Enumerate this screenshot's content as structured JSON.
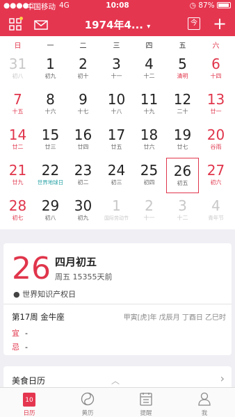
{
  "status": {
    "carrier": "中国移动",
    "network": "4G",
    "time": "10:08",
    "battery": "87%"
  },
  "nav": {
    "title": "1974年4...",
    "today_icon_text": "今"
  },
  "weekdays": [
    "日",
    "一",
    "二",
    "三",
    "四",
    "五",
    "六"
  ],
  "calendar": [
    [
      {
        "n": "31",
        "s": "初八"
      },
      {
        "n": "1",
        "s": "初九"
      },
      {
        "n": "2",
        "s": "初十"
      },
      {
        "n": "3",
        "s": "十一"
      },
      {
        "n": "4",
        "s": "十二"
      },
      {
        "n": "5",
        "s": "清明"
      },
      {
        "n": "6",
        "s": "十四"
      }
    ],
    [
      {
        "n": "7",
        "s": "十五"
      },
      {
        "n": "8",
        "s": "十六"
      },
      {
        "n": "9",
        "s": "十七"
      },
      {
        "n": "10",
        "s": "十八"
      },
      {
        "n": "11",
        "s": "十九"
      },
      {
        "n": "12",
        "s": "二十"
      },
      {
        "n": "13",
        "s": "廿一"
      }
    ],
    [
      {
        "n": "14",
        "s": "廿二"
      },
      {
        "n": "15",
        "s": "廿三"
      },
      {
        "n": "16",
        "s": "廿四"
      },
      {
        "n": "17",
        "s": "廿五"
      },
      {
        "n": "18",
        "s": "廿六"
      },
      {
        "n": "19",
        "s": "廿七"
      },
      {
        "n": "20",
        "s": "谷雨"
      }
    ],
    [
      {
        "n": "21",
        "s": "廿九"
      },
      {
        "n": "22",
        "s": "世界地球日"
      },
      {
        "n": "23",
        "s": "初二"
      },
      {
        "n": "24",
        "s": "初三"
      },
      {
        "n": "25",
        "s": "初四"
      },
      {
        "n": "26",
        "s": "初五"
      },
      {
        "n": "27",
        "s": "初六"
      }
    ],
    [
      {
        "n": "28",
        "s": "初七"
      },
      {
        "n": "29",
        "s": "初八"
      },
      {
        "n": "30",
        "s": "初九"
      },
      {
        "n": "1",
        "s": "国际劳动节"
      },
      {
        "n": "2",
        "s": "十一"
      },
      {
        "n": "3",
        "s": "十二"
      },
      {
        "n": "4",
        "s": "青年节"
      }
    ]
  ],
  "detail": {
    "day": "26",
    "lunar": "四月初五",
    "weekday": "周五  15355天前",
    "festival": "● 世界知识产权日",
    "week_info": "第17周 金牛座",
    "ganzhi": "甲寅[虎]年 戊辰月 丁酉日 乙巳时",
    "yi_label": "宜",
    "yi_value": "-",
    "ji_label": "忌",
    "ji_value": "-"
  },
  "food": {
    "title": "美食日历"
  },
  "tabs": [
    {
      "label": "日历",
      "icon": "calendar-icon"
    },
    {
      "label": "黄历",
      "icon": "yinyang-icon"
    },
    {
      "label": "提醒",
      "icon": "reminder-icon"
    },
    {
      "label": "我",
      "icon": "profile-icon"
    }
  ],
  "colors": {
    "accent": "#e53650",
    "festival_teal": "#27a1a5"
  }
}
